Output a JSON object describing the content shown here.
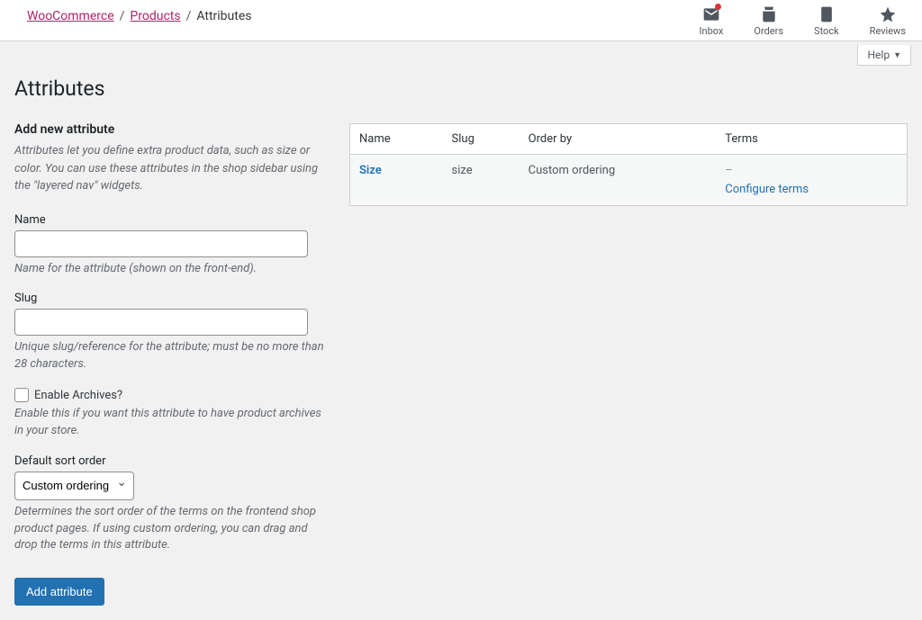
{
  "breadcrumbs": {
    "items": [
      "WooCommerce",
      "Products"
    ],
    "current": "Attributes"
  },
  "top_icons": {
    "inbox": "Inbox",
    "orders": "Orders",
    "stock": "Stock",
    "reviews": "Reviews"
  },
  "help_label": "Help",
  "page_title": "Attributes",
  "add_section": {
    "heading": "Add new attribute",
    "intro": "Attributes let you define extra product data, such as size or color. You can use these attributes in the shop sidebar using the \"layered nav\" widgets.",
    "name": {
      "label": "Name",
      "value": "",
      "hint": "Name for the attribute (shown on the front-end)."
    },
    "slug": {
      "label": "Slug",
      "value": "",
      "hint": "Unique slug/reference for the attribute; must be no more than 28 characters."
    },
    "archives": {
      "label": "Enable Archives?",
      "hint": "Enable this if you want this attribute to have product archives in your store."
    },
    "sort": {
      "label": "Default sort order",
      "selected": "Custom ordering",
      "hint": "Determines the sort order of the terms on the frontend shop product pages. If using custom ordering, you can drag and drop the terms in this attribute."
    },
    "submit_label": "Add attribute"
  },
  "table": {
    "headers": {
      "name": "Name",
      "slug": "Slug",
      "order": "Order by",
      "terms": "Terms"
    },
    "rows": [
      {
        "name": "Size",
        "slug": "size",
        "order": "Custom ordering",
        "terms_dash": "–",
        "configure": "Configure terms"
      }
    ]
  }
}
